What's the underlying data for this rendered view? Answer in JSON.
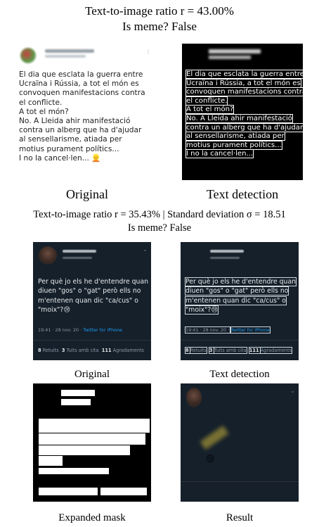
{
  "top": {
    "title_line1": "Text-to-image ratio r = 43.00%",
    "title_line2": "Is meme? False",
    "tweet_text_lines": [
      "El dia que esclata la guerra entre",
      "Ucraïna i Rússia, a tot el món es",
      "convoquen manifestacions contra",
      "el conflicte.",
      "A tot el món?",
      "No. A Lleida ahir manifestació",
      "contra un alberg que ha d'ajudar",
      "al sensellarisme, atiada per",
      "motius purament polítics...",
      "I no la cancel·len..."
    ],
    "caption_left": "Original",
    "caption_right": "Text detection"
  },
  "bottom": {
    "title_line1": "Text-to-image ratio r = 35.43% | Standard deviation σ = 18.51",
    "title_line2": "Is meme? False",
    "tweet_text_lines": [
      "Per què jo els he d'entendre quan",
      "diuen \"gos\" o \"gat\" però ells no",
      "m'entenen quan dic \"ca/cus\" o",
      "\"moix\"?😢"
    ],
    "meta": "19:41 · 28 nov. 20 · ",
    "meta_link": "Twitter for iPhone",
    "stats": {
      "retweets_count": "8",
      "retweets_label": "Retuits",
      "quotes_count": "3",
      "quotes_label": "Tuits amb cita",
      "likes_count": "111",
      "likes_label": "Agradaments"
    },
    "caption_original": "Original",
    "caption_detection": "Text detection",
    "caption_mask": "Expanded mask",
    "caption_result": "Result"
  }
}
